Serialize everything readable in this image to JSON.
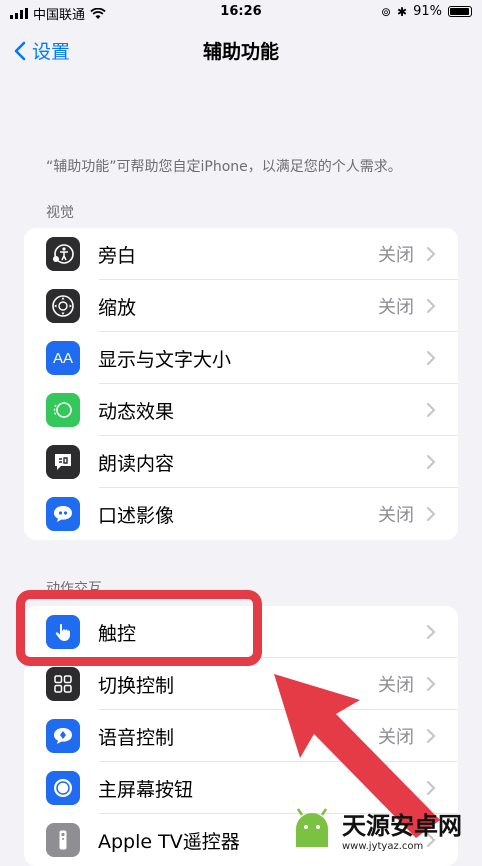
{
  "status": {
    "carrier": "中国联通",
    "time": "16:26",
    "battery": "91%"
  },
  "nav": {
    "back_label": "设置",
    "title": "辅助功能"
  },
  "description": "“辅助功能”可帮助您自定iPhone，以满足您的个人需求。",
  "sections": [
    {
      "label": "视觉",
      "items": [
        {
          "label": "旁白",
          "value": "关闭"
        },
        {
          "label": "缩放",
          "value": "关闭"
        },
        {
          "label": "显示与文字大小",
          "value": ""
        },
        {
          "label": "动态效果",
          "value": ""
        },
        {
          "label": "朗读内容",
          "value": ""
        },
        {
          "label": "口述影像",
          "value": "关闭"
        }
      ]
    },
    {
      "label": "动作交互",
      "items": [
        {
          "label": "触控",
          "value": ""
        },
        {
          "label": "切换控制",
          "value": "关闭"
        },
        {
          "label": "语音控制",
          "value": "关闭"
        },
        {
          "label": "主屏幕按钮",
          "value": ""
        },
        {
          "label": "Apple TV遥控器",
          "value": ""
        }
      ]
    }
  ],
  "watermark": {
    "title": "天源安卓网",
    "url": "www.jytyaz.com"
  },
  "colors": {
    "accent": "#007aff",
    "highlight": "#e53b47"
  }
}
